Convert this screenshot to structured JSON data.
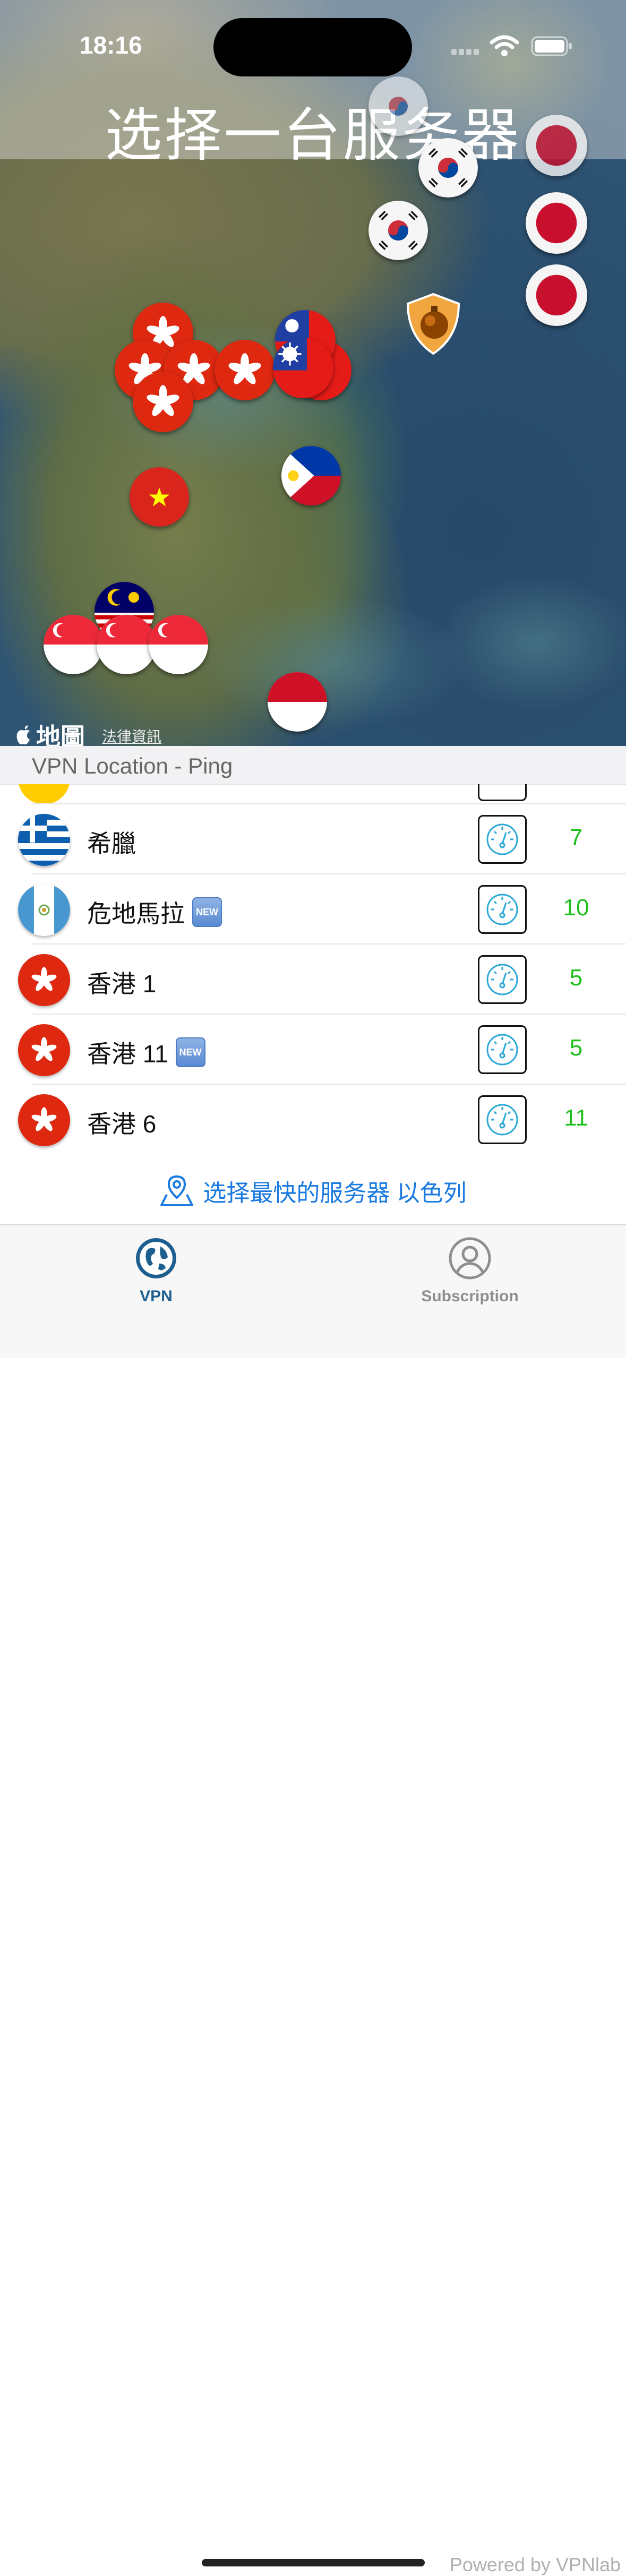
{
  "status_bar": {
    "time": "18:16"
  },
  "map": {
    "title": "选择一台服务器",
    "attribution": "地圖",
    "legal": "法律資訊",
    "markers": [
      "kr",
      "kr",
      "kr",
      "jp",
      "jp",
      "jp",
      "hk",
      "hk",
      "hk",
      "hk",
      "hk",
      "tw",
      "tw",
      "tw",
      "shield",
      "ph",
      "vn",
      "my",
      "sg",
      "sg",
      "sg",
      "id"
    ]
  },
  "list": {
    "header": "VPN Location - Ping",
    "rows": [
      {
        "flag": "gr",
        "name": "希臘",
        "new": false,
        "ping": "7"
      },
      {
        "flag": "gt",
        "name": "危地馬拉",
        "new": true,
        "ping": "10"
      },
      {
        "flag": "hk",
        "name": "香港 1",
        "new": false,
        "ping": "5"
      },
      {
        "flag": "hk",
        "name": "香港 11",
        "new": true,
        "ping": "5"
      },
      {
        "flag": "hk",
        "name": "香港 6",
        "new": false,
        "ping": "11"
      }
    ],
    "new_badge": "NEW",
    "fastest_label": "选择最快的服务器 以色列"
  },
  "tabs": [
    {
      "label": "VPN",
      "icon": "globe-icon",
      "active": true
    },
    {
      "label": "Subscription",
      "icon": "person-icon",
      "active": false
    }
  ],
  "footer": {
    "powered_by": "Powered by VPNlab"
  },
  "colors": {
    "accent": "#1a7ae0",
    "ping_green": "#1fbf1f",
    "tab_active": "#1d5f8e"
  }
}
